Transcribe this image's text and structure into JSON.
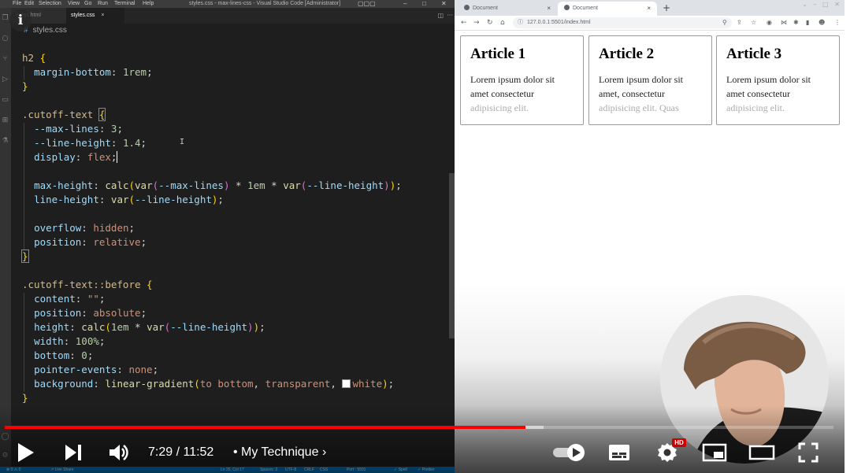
{
  "vscode": {
    "menu": [
      "File",
      "Edit",
      "Selection",
      "View",
      "Go",
      "Run",
      "Terminal",
      "Help"
    ],
    "window_title": "styles.css - max-lines-css - Visual Studio Code [Administrator]",
    "tabs": [
      {
        "label": "index.html",
        "active": false
      },
      {
        "label": "styles.css",
        "active": true,
        "close": "×"
      }
    ],
    "breadcrumb": {
      "symbol": "#",
      "file": "styles.css"
    },
    "code": {
      "l1_sel": "h2",
      "l1_open": "{",
      "l2_prop": "margin-bottom",
      "l2_val": "1rem",
      "l3_close": "}",
      "l5_sel": ".cutoff-text",
      "l5_open": "{",
      "l6_prop": "--max-lines",
      "l6_val": "3",
      "l7_prop": "--line-height",
      "l7_val": "1.4",
      "l8_prop": "display",
      "l8_val": "flex",
      "l10_prop": "max-height",
      "l11_prop": "line-height",
      "l13_prop": "overflow",
      "l13_val": "hidden",
      "l14_prop": "position",
      "l14_val": "relative",
      "l15_close": "}",
      "l17_sel": ".cutoff-text::before",
      "l17_open": "{",
      "l18_prop": "content",
      "l18_val": "\"\"",
      "l19_prop": "position",
      "l19_val": "absolute",
      "l20_prop": "height",
      "l21_prop": "width",
      "l21_val": "100%",
      "l22_prop": "bottom",
      "l22_val": "0",
      "l23_prop": "pointer-events",
      "l23_val": "none",
      "l24_prop": "background",
      "l25_close": "}"
    }
  },
  "browser": {
    "tabs": [
      {
        "label": "Document",
        "close": "×"
      },
      {
        "label": "Document",
        "close": "×"
      }
    ],
    "new_tab": "+",
    "url": "127.0.0.1:5501/index.html",
    "articles": [
      {
        "title": "Article 1",
        "line1": "Lorem ipsum dolor sit",
        "line2": "amet consectetur",
        "line3": "adipisicing elit."
      },
      {
        "title": "Article 2",
        "line1": "Lorem ipsum dolor sit",
        "line2": "amet, consectetur",
        "line3": "adipisicing elit. Quas"
      },
      {
        "title": "Article 3",
        "line1": "Lorem ipsum dolor sit",
        "line2": "amet consectetur",
        "line3": "adipisicing elit."
      }
    ]
  },
  "player": {
    "info": "i",
    "time": "7:29 / 11:52",
    "chapter": "• My Technique",
    "chapter_arrow": "›",
    "hd_badge": "HD",
    "progress_fraction": 0.628,
    "buffered_fraction": 0.65,
    "colors": {
      "played": "#ff0000",
      "buffered": "rgba(255,255,255,0.5)",
      "unplayed": "rgba(255,255,255,0.25)"
    }
  }
}
